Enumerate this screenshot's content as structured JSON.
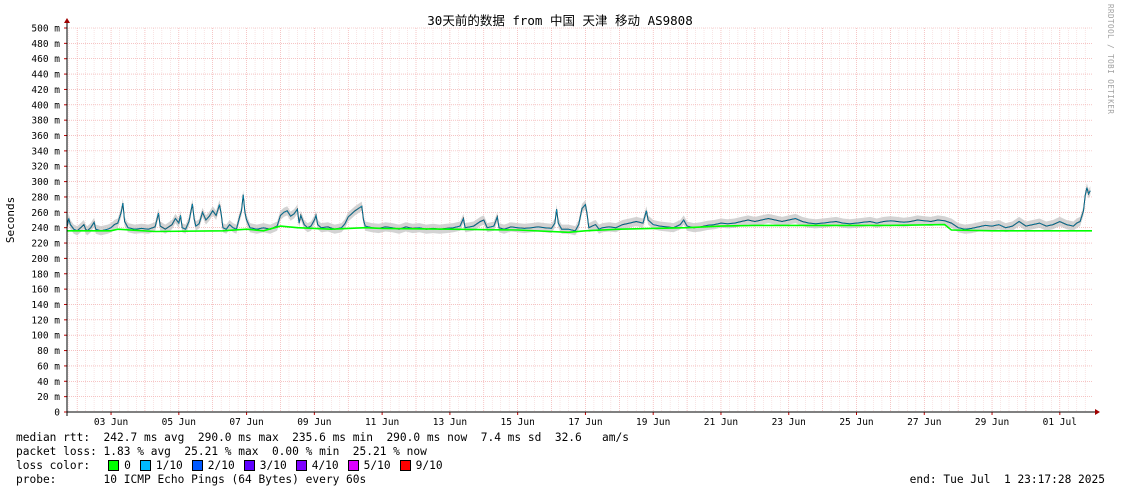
{
  "chart_data": {
    "type": "line",
    "title": "30天前的数据 from 中国 天津 移动 AS9808",
    "ylabel": "Seconds",
    "xlabel": "",
    "yticks": [
      "0",
      "20 m",
      "40 m",
      "60 m",
      "80 m",
      "100 m",
      "120 m",
      "140 m",
      "160 m",
      "180 m",
      "200 m",
      "220 m",
      "240 m",
      "260 m",
      "280 m",
      "300 m",
      "320 m",
      "340 m",
      "360 m",
      "380 m",
      "400 m",
      "420 m",
      "440 m",
      "460 m",
      "480 m",
      "500 m"
    ],
    "ylim": [
      0,
      0.5
    ],
    "xticks": [
      "03 Jun",
      "05 Jun",
      "07 Jun",
      "09 Jun",
      "11 Jun",
      "13 Jun",
      "15 Jun",
      "17 Jun",
      "19 Jun",
      "21 Jun",
      "23 Jun",
      "25 Jun",
      "27 Jun",
      "29 Jun",
      "01 Jul"
    ],
    "xlim_days": [
      1.7,
      31.95
    ],
    "grid": true,
    "loss_colors": [
      "#00ff00",
      "#00b8ff",
      "#0059ff",
      "#5e00ff",
      "#7e00ff",
      "#dd00ff",
      "#ff0000"
    ],
    "series": {
      "rtt_ms": [
        [
          1.7,
          241
        ],
        [
          1.75,
          252
        ],
        [
          1.8,
          244
        ],
        [
          1.9,
          238
        ],
        [
          2.0,
          236
        ],
        [
          2.1,
          240
        ],
        [
          2.2,
          244
        ],
        [
          2.25,
          238
        ],
        [
          2.3,
          236
        ],
        [
          2.4,
          240
        ],
        [
          2.5,
          247
        ],
        [
          2.55,
          238
        ],
        [
          2.7,
          236
        ],
        [
          2.9,
          238
        ],
        [
          3.0,
          240
        ],
        [
          3.1,
          244
        ],
        [
          3.2,
          246
        ],
        [
          3.3,
          260
        ],
        [
          3.35,
          272
        ],
        [
          3.4,
          248
        ],
        [
          3.5,
          240
        ],
        [
          3.7,
          238
        ],
        [
          3.9,
          239
        ],
        [
          4.1,
          238
        ],
        [
          4.3,
          241
        ],
        [
          4.4,
          259
        ],
        [
          4.45,
          242
        ],
        [
          4.6,
          238
        ],
        [
          4.8,
          244
        ],
        [
          4.9,
          252
        ],
        [
          5.0,
          246
        ],
        [
          5.05,
          256
        ],
        [
          5.1,
          240
        ],
        [
          5.2,
          238
        ],
        [
          5.3,
          248
        ],
        [
          5.4,
          271
        ],
        [
          5.45,
          252
        ],
        [
          5.5,
          242
        ],
        [
          5.6,
          245
        ],
        [
          5.7,
          260
        ],
        [
          5.8,
          250
        ],
        [
          5.9,
          255
        ],
        [
          6.0,
          262
        ],
        [
          6.1,
          256
        ],
        [
          6.2,
          270
        ],
        [
          6.25,
          258
        ],
        [
          6.3,
          240
        ],
        [
          6.4,
          238
        ],
        [
          6.5,
          244
        ],
        [
          6.6,
          240
        ],
        [
          6.7,
          238
        ],
        [
          6.8,
          255
        ],
        [
          6.85,
          262
        ],
        [
          6.9,
          283
        ],
        [
          6.95,
          260
        ],
        [
          7.0,
          250
        ],
        [
          7.1,
          240
        ],
        [
          7.3,
          238
        ],
        [
          7.5,
          240
        ],
        [
          7.7,
          238
        ],
        [
          7.9,
          242
        ],
        [
          8.0,
          256
        ],
        [
          8.1,
          260
        ],
        [
          8.2,
          262
        ],
        [
          8.3,
          255
        ],
        [
          8.4,
          258
        ],
        [
          8.5,
          264
        ],
        [
          8.55,
          246
        ],
        [
          8.6,
          256
        ],
        [
          8.7,
          244
        ],
        [
          8.8,
          240
        ],
        [
          8.9,
          242
        ],
        [
          9.0,
          250
        ],
        [
          9.05,
          256
        ],
        [
          9.1,
          244
        ],
        [
          9.2,
          240
        ],
        [
          9.4,
          241
        ],
        [
          9.6,
          238
        ],
        [
          9.8,
          240
        ],
        [
          9.9,
          245
        ],
        [
          10.0,
          254
        ],
        [
          10.1,
          258
        ],
        [
          10.2,
          262
        ],
        [
          10.3,
          265
        ],
        [
          10.4,
          268
        ],
        [
          10.45,
          250
        ],
        [
          10.5,
          242
        ],
        [
          10.7,
          240
        ],
        [
          10.9,
          239
        ],
        [
          11.1,
          241
        ],
        [
          11.3,
          240
        ],
        [
          11.5,
          238
        ],
        [
          11.7,
          241
        ],
        [
          11.9,
          239
        ],
        [
          12.1,
          240
        ],
        [
          12.3,
          238
        ],
        [
          12.5,
          239
        ],
        [
          12.7,
          238
        ],
        [
          12.9,
          239
        ],
        [
          13.1,
          240
        ],
        [
          13.3,
          242
        ],
        [
          13.4,
          252
        ],
        [
          13.45,
          240
        ],
        [
          13.7,
          242
        ],
        [
          13.9,
          248
        ],
        [
          14.0,
          250
        ],
        [
          14.1,
          240
        ],
        [
          14.3,
          242
        ],
        [
          14.4,
          254
        ],
        [
          14.45,
          240
        ],
        [
          14.6,
          238
        ],
        [
          14.8,
          241
        ],
        [
          15.0,
          240
        ],
        [
          15.2,
          239
        ],
        [
          15.4,
          240
        ],
        [
          15.6,
          241
        ],
        [
          15.8,
          240
        ],
        [
          16.0,
          239
        ],
        [
          16.1,
          246
        ],
        [
          16.15,
          264
        ],
        [
          16.2,
          246
        ],
        [
          16.3,
          238
        ],
        [
          16.5,
          238
        ],
        [
          16.7,
          236
        ],
        [
          16.8,
          244
        ],
        [
          16.9,
          265
        ],
        [
          17.0,
          270
        ],
        [
          17.05,
          258
        ],
        [
          17.1,
          240
        ],
        [
          17.2,
          242
        ],
        [
          17.3,
          244
        ],
        [
          17.4,
          238
        ],
        [
          17.5,
          240
        ],
        [
          17.7,
          241
        ],
        [
          17.9,
          240
        ],
        [
          18.1,
          244
        ],
        [
          18.3,
          246
        ],
        [
          18.5,
          248
        ],
        [
          18.7,
          246
        ],
        [
          18.8,
          262
        ],
        [
          18.85,
          250
        ],
        [
          19.0,
          244
        ],
        [
          19.2,
          242
        ],
        [
          19.4,
          241
        ],
        [
          19.6,
          240
        ],
        [
          19.8,
          244
        ],
        [
          19.9,
          250
        ],
        [
          20.0,
          242
        ],
        [
          20.2,
          240
        ],
        [
          20.4,
          241
        ],
        [
          20.6,
          243
        ],
        [
          20.8,
          244
        ],
        [
          21.0,
          246
        ],
        [
          21.2,
          245
        ],
        [
          21.4,
          246
        ],
        [
          21.6,
          248
        ],
        [
          21.8,
          250
        ],
        [
          22.0,
          248
        ],
        [
          22.2,
          250
        ],
        [
          22.4,
          252
        ],
        [
          22.6,
          250
        ],
        [
          22.8,
          248
        ],
        [
          23.0,
          250
        ],
        [
          23.2,
          252
        ],
        [
          23.4,
          248
        ],
        [
          23.6,
          246
        ],
        [
          23.8,
          245
        ],
        [
          24.0,
          246
        ],
        [
          24.2,
          247
        ],
        [
          24.4,
          248
        ],
        [
          24.6,
          246
        ],
        [
          24.8,
          245
        ],
        [
          25.0,
          246
        ],
        [
          25.2,
          247
        ],
        [
          25.4,
          248
        ],
        [
          25.6,
          246
        ],
        [
          25.8,
          248
        ],
        [
          26.0,
          249
        ],
        [
          26.2,
          248
        ],
        [
          26.4,
          247
        ],
        [
          26.6,
          248
        ],
        [
          26.8,
          250
        ],
        [
          27.0,
          249
        ],
        [
          27.2,
          248
        ],
        [
          27.4,
          250
        ],
        [
          27.6,
          249
        ],
        [
          27.8,
          246
        ],
        [
          28.0,
          240
        ],
        [
          28.2,
          238
        ],
        [
          28.4,
          239
        ],
        [
          28.6,
          241
        ],
        [
          28.8,
          243
        ],
        [
          29.0,
          242
        ],
        [
          29.2,
          244
        ],
        [
          29.4,
          240
        ],
        [
          29.6,
          242
        ],
        [
          29.8,
          248
        ],
        [
          30.0,
          242
        ],
        [
          30.2,
          244
        ],
        [
          30.4,
          246
        ],
        [
          30.6,
          242
        ],
        [
          30.8,
          244
        ],
        [
          31.0,
          248
        ],
        [
          31.2,
          244
        ],
        [
          31.4,
          242
        ],
        [
          31.5,
          246
        ],
        [
          31.6,
          248
        ],
        [
          31.7,
          262
        ],
        [
          31.75,
          282
        ],
        [
          31.8,
          292
        ],
        [
          31.85,
          284
        ],
        [
          31.9,
          288
        ]
      ],
      "median_loss0_ms": [
        [
          1.7,
          236
        ],
        [
          3.0,
          236
        ],
        [
          3.2,
          238
        ],
        [
          4.3,
          235
        ],
        [
          6.3,
          236
        ],
        [
          7.0,
          238
        ],
        [
          7.5,
          236
        ],
        [
          8.0,
          242
        ],
        [
          8.5,
          240
        ],
        [
          9.5,
          238
        ],
        [
          10.5,
          240
        ],
        [
          11.0,
          239
        ],
        [
          13.0,
          238
        ],
        [
          15.0,
          237
        ],
        [
          16.5,
          234
        ],
        [
          17.0,
          236
        ],
        [
          18.0,
          238
        ],
        [
          20.0,
          240
        ],
        [
          21.0,
          242
        ],
        [
          22.0,
          243
        ],
        [
          24.0,
          243
        ],
        [
          26.0,
          243
        ],
        [
          27.6,
          244
        ],
        [
          27.8,
          237
        ],
        [
          29.0,
          236
        ],
        [
          31.0,
          236
        ],
        [
          31.95,
          236
        ]
      ]
    }
  },
  "summary": {
    "median_rtt": "median rtt:  242.7 ms avg  290.0 ms max  235.6 ms min  290.0 ms now  7.4 ms sd  32.6   am/s",
    "packet_loss": "packet loss: 1.83 % avg  25.21 % max  0.00 % min  25.21 % now",
    "loss_color_label": "loss color:",
    "loss_items": [
      {
        "label": "0",
        "color": "#00ff00"
      },
      {
        "label": "1/10",
        "color": "#00b8ff"
      },
      {
        "label": "2/10",
        "color": "#0059ff"
      },
      {
        "label": "3/10",
        "color": "#5e00ff"
      },
      {
        "label": "4/10",
        "color": "#7e00ff"
      },
      {
        "label": "5/10",
        "color": "#dd00ff"
      },
      {
        "label": "9/10",
        "color": "#ff0000"
      }
    ],
    "probe": "probe:       10 ICMP Echo Pings (64 Bytes) every 60s",
    "end": "end: Tue Jul  1 23:17:28 2025"
  },
  "watermark": "RRDTOOL / TOBI OETIKER"
}
